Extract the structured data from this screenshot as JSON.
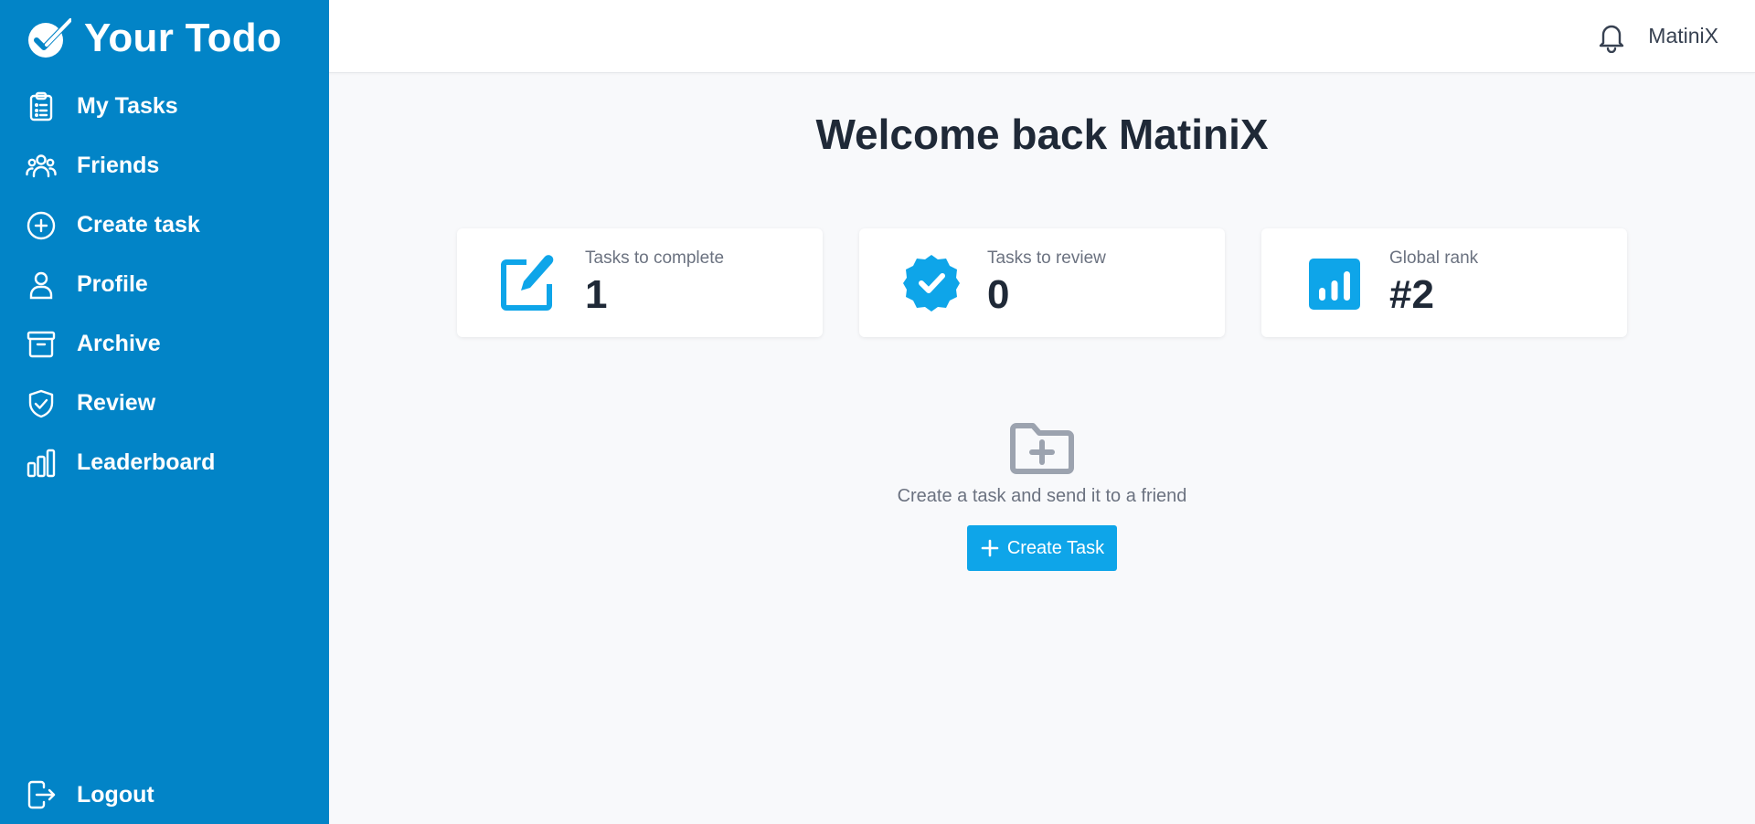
{
  "brand": {
    "title": "Your Todo",
    "icon": "check-badge-icon"
  },
  "sidebar": {
    "items": [
      {
        "label": "My Tasks",
        "icon": "clipboard-list-icon"
      },
      {
        "label": "Friends",
        "icon": "users-icon"
      },
      {
        "label": "Create task",
        "icon": "plus-circle-icon"
      },
      {
        "label": "Profile",
        "icon": "user-icon"
      },
      {
        "label": "Archive",
        "icon": "archive-box-icon"
      },
      {
        "label": "Review",
        "icon": "shield-check-icon"
      },
      {
        "label": "Leaderboard",
        "icon": "bar-chart-icon"
      }
    ],
    "logout": {
      "label": "Logout",
      "icon": "logout-icon"
    }
  },
  "header": {
    "username": "MatiniX",
    "bell_icon": "bell-icon"
  },
  "main": {
    "welcome": "Welcome back MatiniX",
    "cards": [
      {
        "label": "Tasks to complete",
        "value": "1",
        "icon": "edit-icon"
      },
      {
        "label": "Tasks to review",
        "value": "0",
        "icon": "check-badge-icon"
      },
      {
        "label": "Global rank",
        "value": "#2",
        "icon": "chart-icon"
      }
    ],
    "empty_state": {
      "text": "Create a task and send it to a friend",
      "button_label": "Create Task",
      "icon": "folder-plus-icon"
    }
  },
  "colors": {
    "sidebar_bg": "#0284c7",
    "accent": "#0ea5e9",
    "page_bg": "#f8f9fb",
    "text_dark": "#1f2937"
  }
}
